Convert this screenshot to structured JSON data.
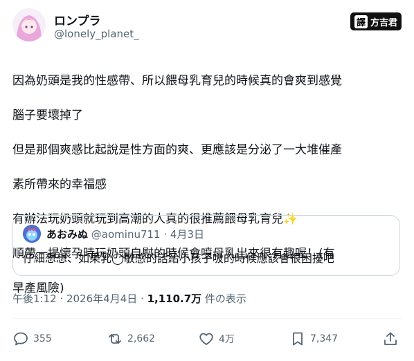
{
  "author": {
    "name": "ロンプラ",
    "handle": "@lonely_planet_"
  },
  "stamp": {
    "badge": "譯",
    "text": "方吉君"
  },
  "post": {
    "lines": [
      "因為奶頭是我的性感帶、所以餵母乳育兒的時候真的會爽到感覺",
      "腦子要壞掉了",
      "但是那個爽感比起說是性方面的爽、更應該是分泌了一大堆催產",
      "素所帶來的幸福感",
      "有辦法玩奶頭就玩到高潮的人真的很推薦餵母乳育兒",
      "順帶一提懷孕時玩奶頭自慰的時候會噴母乳出來很有趣喔！(有",
      "早產風險)"
    ],
    "sparkle": "✨"
  },
  "quote": {
    "name": "あおみぬ",
    "handle": "@aominu711",
    "sep": " · ",
    "date": "4月3日",
    "text": "仔細想想、如果乳◯敏感的話給小孩子吸的時候應該會很困擾吧"
  },
  "meta": {
    "time": "午後1:12 · 2026年4月4日 · ",
    "views": "1,110.7万",
    "views_suffix": " 件の表示"
  },
  "actions": {
    "replies": "355",
    "reposts": "2,662",
    "likes": "4万",
    "bookmarks": "7,347"
  },
  "icons": [
    "reply-icon",
    "repost-icon",
    "like-icon",
    "bookmark-icon",
    "share-icon"
  ],
  "colors": {
    "text": "#0f1419",
    "secondary": "#536471",
    "border": "#cfd9de"
  }
}
